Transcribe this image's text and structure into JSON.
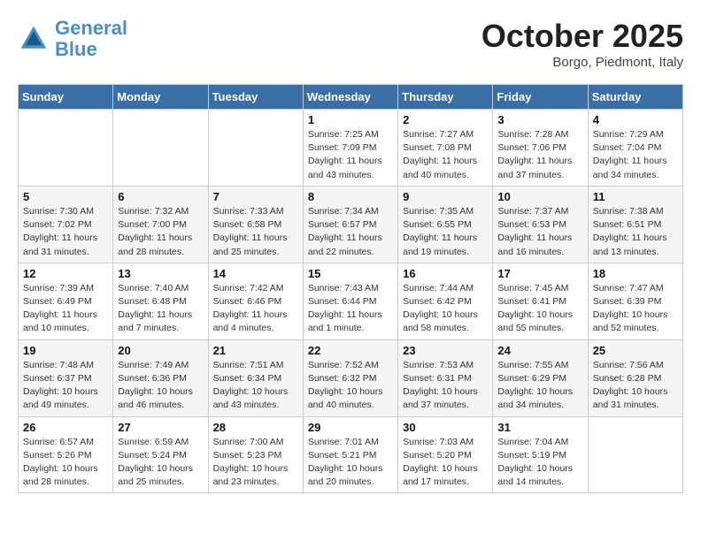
{
  "header": {
    "logo_line1": "General",
    "logo_line2": "Blue",
    "month": "October 2025",
    "location": "Borgo, Piedmont, Italy"
  },
  "weekdays": [
    "Sunday",
    "Monday",
    "Tuesday",
    "Wednesday",
    "Thursday",
    "Friday",
    "Saturday"
  ],
  "weeks": [
    [
      {
        "day": "",
        "sunrise": "",
        "sunset": "",
        "daylight": ""
      },
      {
        "day": "",
        "sunrise": "",
        "sunset": "",
        "daylight": ""
      },
      {
        "day": "",
        "sunrise": "",
        "sunset": "",
        "daylight": ""
      },
      {
        "day": "1",
        "sunrise": "Sunrise: 7:25 AM",
        "sunset": "Sunset: 7:09 PM",
        "daylight": "Daylight: 11 hours and 43 minutes."
      },
      {
        "day": "2",
        "sunrise": "Sunrise: 7:27 AM",
        "sunset": "Sunset: 7:08 PM",
        "daylight": "Daylight: 11 hours and 40 minutes."
      },
      {
        "day": "3",
        "sunrise": "Sunrise: 7:28 AM",
        "sunset": "Sunset: 7:06 PM",
        "daylight": "Daylight: 11 hours and 37 minutes."
      },
      {
        "day": "4",
        "sunrise": "Sunrise: 7:29 AM",
        "sunset": "Sunset: 7:04 PM",
        "daylight": "Daylight: 11 hours and 34 minutes."
      }
    ],
    [
      {
        "day": "5",
        "sunrise": "Sunrise: 7:30 AM",
        "sunset": "Sunset: 7:02 PM",
        "daylight": "Daylight: 11 hours and 31 minutes."
      },
      {
        "day": "6",
        "sunrise": "Sunrise: 7:32 AM",
        "sunset": "Sunset: 7:00 PM",
        "daylight": "Daylight: 11 hours and 28 minutes."
      },
      {
        "day": "7",
        "sunrise": "Sunrise: 7:33 AM",
        "sunset": "Sunset: 6:58 PM",
        "daylight": "Daylight: 11 hours and 25 minutes."
      },
      {
        "day": "8",
        "sunrise": "Sunrise: 7:34 AM",
        "sunset": "Sunset: 6:57 PM",
        "daylight": "Daylight: 11 hours and 22 minutes."
      },
      {
        "day": "9",
        "sunrise": "Sunrise: 7:35 AM",
        "sunset": "Sunset: 6:55 PM",
        "daylight": "Daylight: 11 hours and 19 minutes."
      },
      {
        "day": "10",
        "sunrise": "Sunrise: 7:37 AM",
        "sunset": "Sunset: 6:53 PM",
        "daylight": "Daylight: 11 hours and 16 minutes."
      },
      {
        "day": "11",
        "sunrise": "Sunrise: 7:38 AM",
        "sunset": "Sunset: 6:51 PM",
        "daylight": "Daylight: 11 hours and 13 minutes."
      }
    ],
    [
      {
        "day": "12",
        "sunrise": "Sunrise: 7:39 AM",
        "sunset": "Sunset: 6:49 PM",
        "daylight": "Daylight: 11 hours and 10 minutes."
      },
      {
        "day": "13",
        "sunrise": "Sunrise: 7:40 AM",
        "sunset": "Sunset: 6:48 PM",
        "daylight": "Daylight: 11 hours and 7 minutes."
      },
      {
        "day": "14",
        "sunrise": "Sunrise: 7:42 AM",
        "sunset": "Sunset: 6:46 PM",
        "daylight": "Daylight: 11 hours and 4 minutes."
      },
      {
        "day": "15",
        "sunrise": "Sunrise: 7:43 AM",
        "sunset": "Sunset: 6:44 PM",
        "daylight": "Daylight: 11 hours and 1 minute."
      },
      {
        "day": "16",
        "sunrise": "Sunrise: 7:44 AM",
        "sunset": "Sunset: 6:42 PM",
        "daylight": "Daylight: 10 hours and 58 minutes."
      },
      {
        "day": "17",
        "sunrise": "Sunrise: 7:45 AM",
        "sunset": "Sunset: 6:41 PM",
        "daylight": "Daylight: 10 hours and 55 minutes."
      },
      {
        "day": "18",
        "sunrise": "Sunrise: 7:47 AM",
        "sunset": "Sunset: 6:39 PM",
        "daylight": "Daylight: 10 hours and 52 minutes."
      }
    ],
    [
      {
        "day": "19",
        "sunrise": "Sunrise: 7:48 AM",
        "sunset": "Sunset: 6:37 PM",
        "daylight": "Daylight: 10 hours and 49 minutes."
      },
      {
        "day": "20",
        "sunrise": "Sunrise: 7:49 AM",
        "sunset": "Sunset: 6:36 PM",
        "daylight": "Daylight: 10 hours and 46 minutes."
      },
      {
        "day": "21",
        "sunrise": "Sunrise: 7:51 AM",
        "sunset": "Sunset: 6:34 PM",
        "daylight": "Daylight: 10 hours and 43 minutes."
      },
      {
        "day": "22",
        "sunrise": "Sunrise: 7:52 AM",
        "sunset": "Sunset: 6:32 PM",
        "daylight": "Daylight: 10 hours and 40 minutes."
      },
      {
        "day": "23",
        "sunrise": "Sunrise: 7:53 AM",
        "sunset": "Sunset: 6:31 PM",
        "daylight": "Daylight: 10 hours and 37 minutes."
      },
      {
        "day": "24",
        "sunrise": "Sunrise: 7:55 AM",
        "sunset": "Sunset: 6:29 PM",
        "daylight": "Daylight: 10 hours and 34 minutes."
      },
      {
        "day": "25",
        "sunrise": "Sunrise: 7:56 AM",
        "sunset": "Sunset: 6:28 PM",
        "daylight": "Daylight: 10 hours and 31 minutes."
      }
    ],
    [
      {
        "day": "26",
        "sunrise": "Sunrise: 6:57 AM",
        "sunset": "Sunset: 5:26 PM",
        "daylight": "Daylight: 10 hours and 28 minutes."
      },
      {
        "day": "27",
        "sunrise": "Sunrise: 6:59 AM",
        "sunset": "Sunset: 5:24 PM",
        "daylight": "Daylight: 10 hours and 25 minutes."
      },
      {
        "day": "28",
        "sunrise": "Sunrise: 7:00 AM",
        "sunset": "Sunset: 5:23 PM",
        "daylight": "Daylight: 10 hours and 23 minutes."
      },
      {
        "day": "29",
        "sunrise": "Sunrise: 7:01 AM",
        "sunset": "Sunset: 5:21 PM",
        "daylight": "Daylight: 10 hours and 20 minutes."
      },
      {
        "day": "30",
        "sunrise": "Sunrise: 7:03 AM",
        "sunset": "Sunset: 5:20 PM",
        "daylight": "Daylight: 10 hours and 17 minutes."
      },
      {
        "day": "31",
        "sunrise": "Sunrise: 7:04 AM",
        "sunset": "Sunset: 5:19 PM",
        "daylight": "Daylight: 10 hours and 14 minutes."
      },
      {
        "day": "",
        "sunrise": "",
        "sunset": "",
        "daylight": ""
      }
    ]
  ]
}
